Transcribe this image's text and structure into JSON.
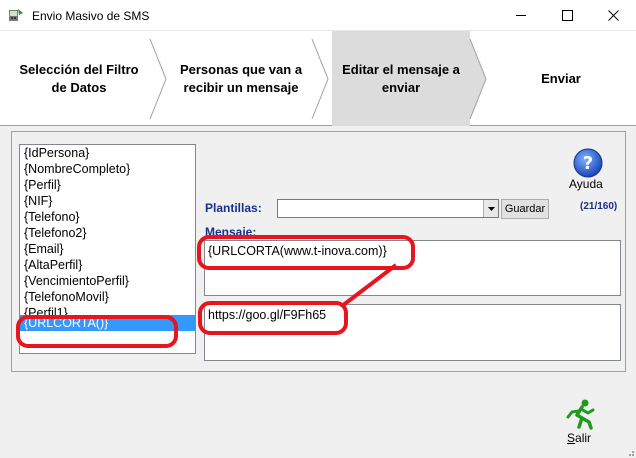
{
  "window": {
    "title": "Envio Masivo de SMS",
    "icon": "app-icon",
    "controls": {
      "minimize": "minimize-icon",
      "maximize": "maximize-icon",
      "close": "close-icon"
    }
  },
  "wizard": {
    "steps": [
      {
        "line1": "Selección del Filtro",
        "line2": "de Datos",
        "active": false
      },
      {
        "line1": "Personas que van a",
        "line2": "recibir un mensaje",
        "active": false
      },
      {
        "line1": "Editar el mensaje a",
        "line2": "enviar",
        "active": true
      },
      {
        "line1": "Enviar",
        "line2": "",
        "active": false
      }
    ]
  },
  "fields": {
    "items": [
      "{IdPersona}",
      "{NombreCompleto}",
      "{Perfil}",
      "{NIF}",
      "{Telefono}",
      "{Telefono2}",
      "{Email}",
      "{AltaPerfil}",
      "{VencimientoPerfil}",
      "{TelefonoMovil}",
      "{Perfil1}",
      "{URLCORTA()}"
    ],
    "selected_index": 11
  },
  "help": {
    "label": "Ayuda",
    "icon": "help-icon"
  },
  "templates": {
    "label": "Plantillas:",
    "selected": "",
    "save_label": "Guardar",
    "counter": "(21/160)"
  },
  "message": {
    "label": "Mensaje:",
    "text": "{URLCORTA(www.t-inova.com)}",
    "result": "https://goo.gl/F9Fh65"
  },
  "exit": {
    "label_accel": "S",
    "label_rest": "alir",
    "icon": "running-man-icon"
  },
  "colors": {
    "label_blue": "#1a2f8a",
    "selection": "#3399ff",
    "annotation_red": "#e8141e"
  }
}
